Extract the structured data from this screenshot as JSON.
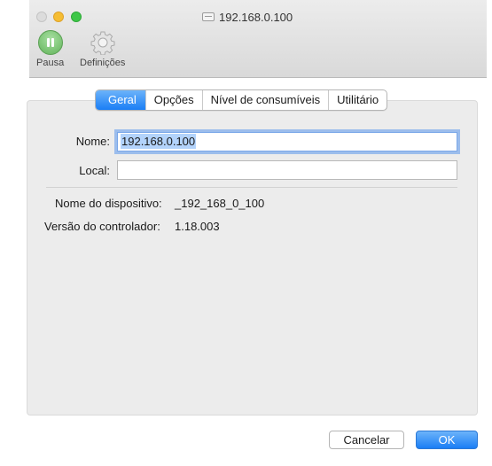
{
  "window": {
    "title": "192.168.0.100"
  },
  "toolbar": {
    "pause_label": "Pausa",
    "settings_label": "Definições"
  },
  "tabs": [
    {
      "label": "Geral",
      "active": true
    },
    {
      "label": "Opções",
      "active": false
    },
    {
      "label": "Nível de consumíveis",
      "active": false
    },
    {
      "label": "Utilitário",
      "active": false
    }
  ],
  "form": {
    "name_label": "Nome:",
    "name_value": "192.168.0.100",
    "location_label": "Local:",
    "location_value": ""
  },
  "info": {
    "device_name_label": "Nome do dispositivo:",
    "device_name_value": "_192_168_0_100",
    "driver_version_label": "Versão do controlador:",
    "driver_version_value": "1.18.003"
  },
  "buttons": {
    "cancel_label": "Cancelar",
    "ok_label": "OK"
  },
  "colors": {
    "accent": "#1a7ef5",
    "selection": "#b3d3fb",
    "pause_green": "#62b35a"
  },
  "icons": {
    "title": "printer-icon",
    "pause": "pause-icon",
    "settings": "gear-icon"
  }
}
